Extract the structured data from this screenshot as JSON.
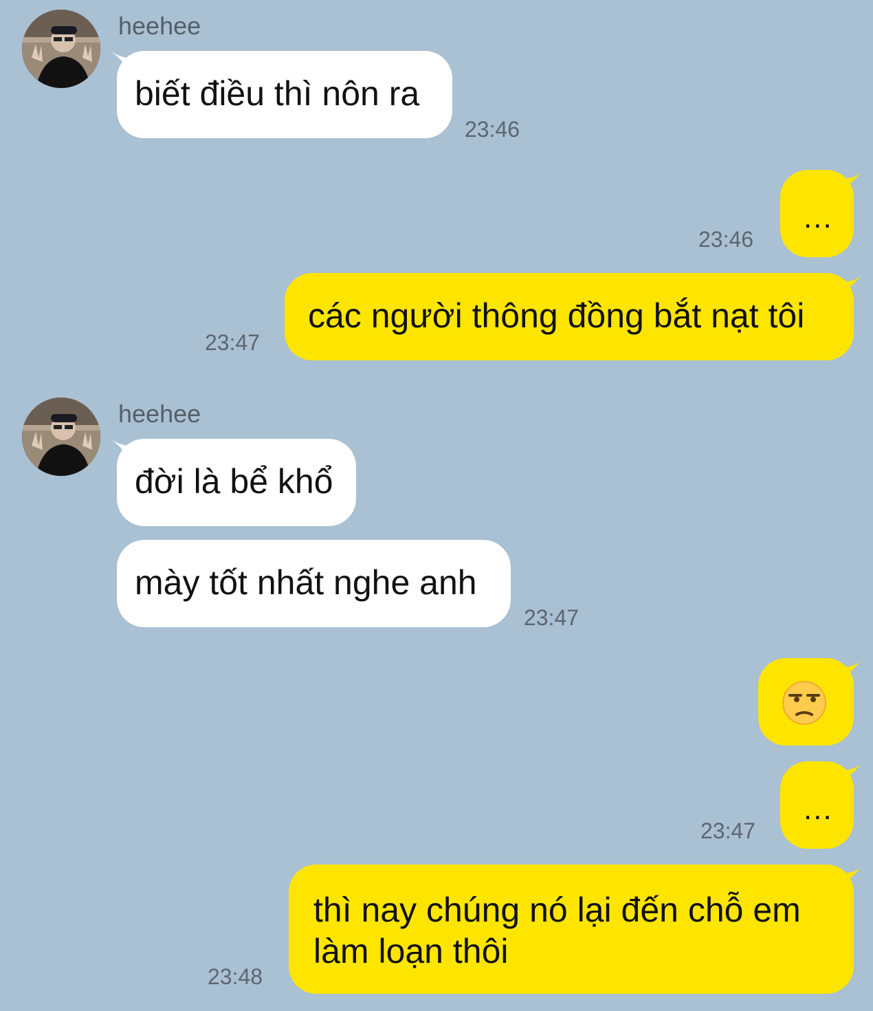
{
  "colors": {
    "background": "#aac0d3",
    "incoming_bubble": "#ffffff",
    "outgoing_bubble": "#fee500",
    "timestamp": "#5d6670",
    "sender_name": "#545f69"
  },
  "messages": [
    {
      "sender": "heehee",
      "text": "biết điều thì nôn ra",
      "time": "23:46"
    },
    {
      "text": "...",
      "time": "23:46"
    },
    {
      "text": "các người thông đồng bắt nạt tôi",
      "time": "23:47"
    },
    {
      "sender": "heehee",
      "text": "đời là bể khổ"
    },
    {
      "text": "mày tốt nhất nghe anh",
      "time": "23:47"
    },
    {
      "emoji": "unamused-face-emoji"
    },
    {
      "text": "...",
      "time": "23:47"
    },
    {
      "text": "thì nay chúng nó lại đến chỗ em làm loạn thôi",
      "time": "23:48"
    }
  ]
}
